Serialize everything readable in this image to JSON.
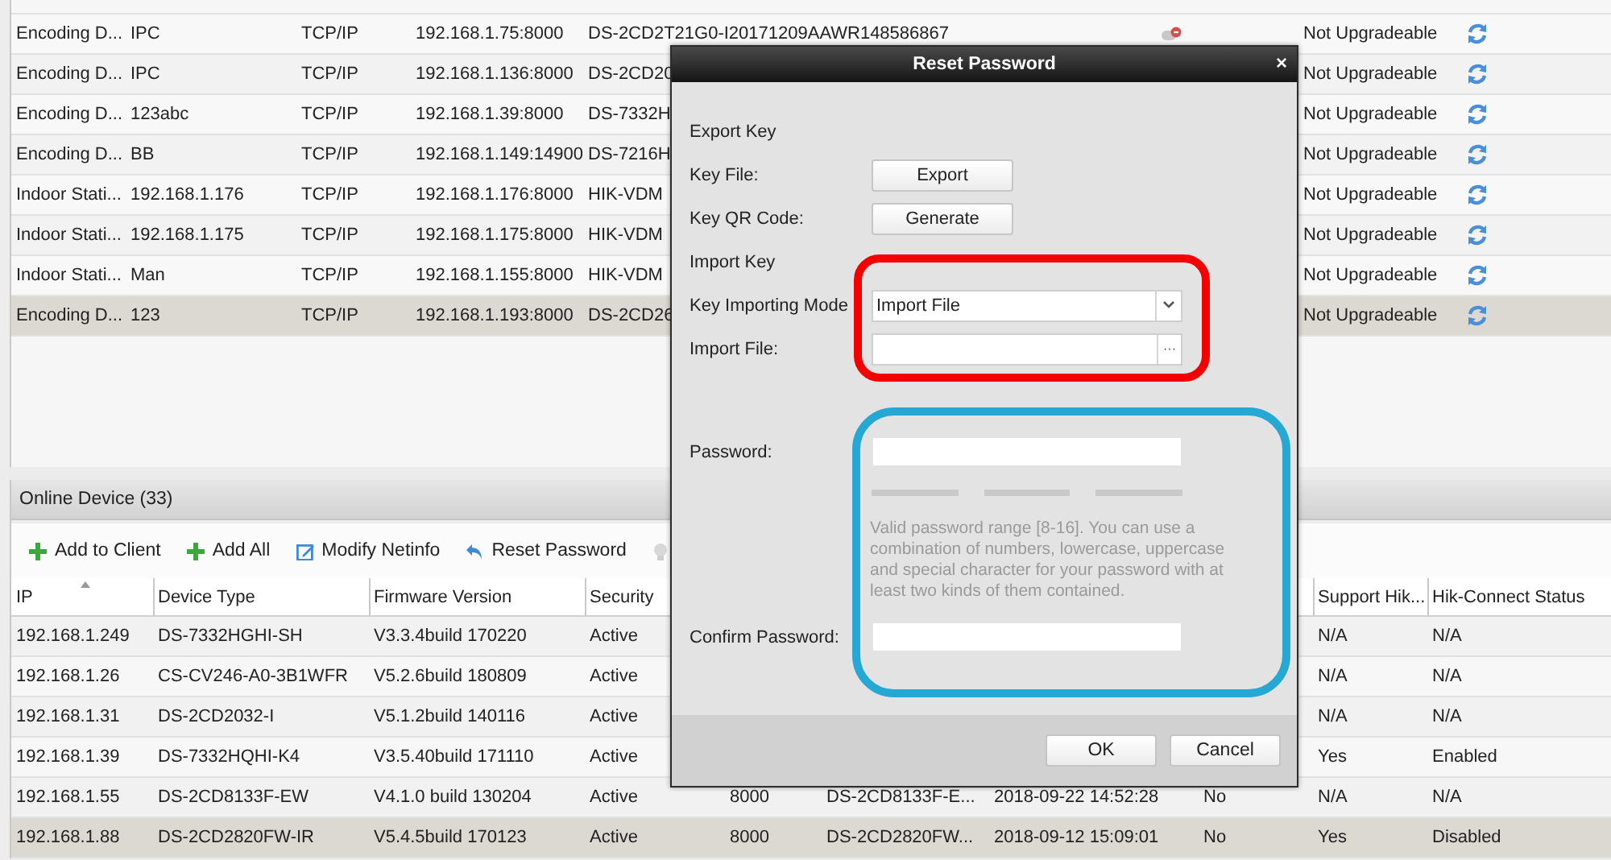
{
  "device_list": {
    "rows": [
      {
        "column_1": "Encoding D...",
        "column_2": "IPC",
        "column_3": "TCP/IP",
        "column_4": "192.168.1.75:8000",
        "column_5": "DS-2CD2T21G0-I20171209AAWR148586867",
        "offline": true,
        "column_7": "Not Upgradeable",
        "selected": false
      },
      {
        "column_1": "Encoding D...",
        "column_2": "IPC",
        "column_3": "TCP/IP",
        "column_4": "192.168.1.136:8000",
        "column_5": "DS-2CD20",
        "column_7": "Not Upgradeable",
        "selected": false
      },
      {
        "column_1": "Encoding D...",
        "column_2": "123abc",
        "column_3": "TCP/IP",
        "column_4": "192.168.1.39:8000",
        "column_5": "DS-7332H",
        "column_7": "Not Upgradeable",
        "selected": false
      },
      {
        "column_1": "Encoding D...",
        "column_2": "BB",
        "column_3": "TCP/IP",
        "column_4": "192.168.1.149:14900",
        "column_5": "DS-7216H",
        "column_7": "Not Upgradeable",
        "selected": false
      },
      {
        "column_1": "Indoor Stati...",
        "column_2": "192.168.1.176",
        "column_3": "TCP/IP",
        "column_4": "192.168.1.176:8000",
        "column_5": "HIK-VDM",
        "column_7": "Not Upgradeable",
        "selected": false
      },
      {
        "column_1": "Indoor Stati...",
        "column_2": "192.168.1.175",
        "column_3": "TCP/IP",
        "column_4": "192.168.1.175:8000",
        "column_5": "HIK-VDM",
        "column_7": "Not Upgradeable",
        "selected": false
      },
      {
        "column_1": "Indoor Stati...",
        "column_2": "Man",
        "column_3": "TCP/IP",
        "column_4": "192.168.1.155:8000",
        "column_5": "HIK-VDM",
        "column_7": "Not Upgradeable",
        "selected": false
      },
      {
        "column_1": "Encoding D...",
        "column_2": "123",
        "column_3": "TCP/IP",
        "column_4": "192.168.1.193:8000",
        "column_5": "DS-2CD26",
        "column_7": "Not Upgradeable",
        "selected": true
      }
    ]
  },
  "online_device": {
    "title": "Online Device (33)",
    "toolbar": [
      {
        "kind": "add",
        "label": "Add to Client"
      },
      {
        "kind": "add",
        "label": "Add All"
      },
      {
        "kind": "edit",
        "label": "Modify Netinfo"
      },
      {
        "kind": "reset",
        "label": "Reset Password"
      },
      {
        "kind": "hint"
      }
    ],
    "columns": {
      "ip": {
        "label": "IP",
        "sorted": true
      },
      "device_type": {
        "label": "Device Type",
        "sorted": false
      },
      "firmware_version": {
        "label": "Firmware Version",
        "sorted": false
      },
      "security": {
        "label": "Security",
        "sorted": false
      },
      "support_hik": {
        "label": "Support Hik...",
        "sorted": false
      },
      "hik_connect_status": {
        "label": "Hik-Connect Status",
        "sorted": false
      }
    },
    "rows": [
      {
        "ip": "192.168.1.249",
        "device_type": "DS-7332HGHI-SH",
        "firmware_version": "V3.3.4build 170220",
        "security": "Active",
        "support_hik": "N/A",
        "hik_connect_status": "N/A",
        "selected": false
      },
      {
        "ip": "192.168.1.26",
        "device_type": "CS-CV246-A0-3B1WFR",
        "firmware_version": "V5.2.6build 180809",
        "security": "Active",
        "support_hik": "N/A",
        "hik_connect_status": "N/A",
        "selected": false
      },
      {
        "ip": "192.168.1.31",
        "device_type": "DS-2CD2032-I",
        "firmware_version": "V5.1.2build 140116",
        "security": "Active",
        "support_hik": "N/A",
        "hik_connect_status": "N/A",
        "selected": false
      },
      {
        "ip": "192.168.1.39",
        "device_type": "DS-7332HQHI-K4",
        "firmware_version": "V3.5.40build 171110",
        "security": "Active",
        "support_hik": "Yes",
        "hik_connect_status": "Enabled",
        "selected": false
      },
      {
        "ip": "192.168.1.55",
        "device_type": "DS-2CD8133F-EW",
        "firmware_version": "V4.1.0 build 130204",
        "security": "Active",
        "column_5": "8000",
        "column_6": "DS-2CD8133F-E...",
        "column_7": "2018-09-22 14:52:28",
        "column_8": "No",
        "support_hik": "N/A",
        "hik_connect_status": "N/A",
        "selected": false
      },
      {
        "ip": "192.168.1.88",
        "device_type": "DS-2CD2820FW-IR",
        "firmware_version": "V5.4.5build 170123",
        "security": "Active",
        "column_5": "8000",
        "column_6": "DS-2CD2820FW...",
        "column_7": "2018-09-12 15:09:01",
        "column_8": "No",
        "support_hik": "Yes",
        "hik_connect_status": "Disabled",
        "selected": true
      }
    ]
  },
  "dialog": {
    "title": "Reset Password",
    "close": "×",
    "rows": [
      {
        "kind": "heading",
        "label": "Export Key"
      },
      {
        "kind": "button",
        "label": "Key File:",
        "button": "Export"
      },
      {
        "kind": "button",
        "label": "Key QR Code:",
        "button": "Generate"
      },
      {
        "kind": "heading",
        "label": "Import Key"
      },
      {
        "kind": "select",
        "label": "Key Importing Mode",
        "value": "Import File"
      },
      {
        "kind": "file",
        "label": "Import File:",
        "browse": "···"
      },
      {
        "kind": "password",
        "label": "Password:"
      },
      {
        "kind": "strength"
      },
      {
        "kind": "hint",
        "text": "Valid password range [8-16]. You can use a combination of numbers, lowercase, uppercase and special character for your password with at least two kinds of them contained."
      },
      {
        "kind": "password",
        "label": "Confirm Password:"
      }
    ],
    "buttons": [
      "OK",
      "Cancel"
    ]
  },
  "annotations": [
    {
      "color": "#f50000"
    },
    {
      "color": "#26a8d5"
    }
  ]
}
